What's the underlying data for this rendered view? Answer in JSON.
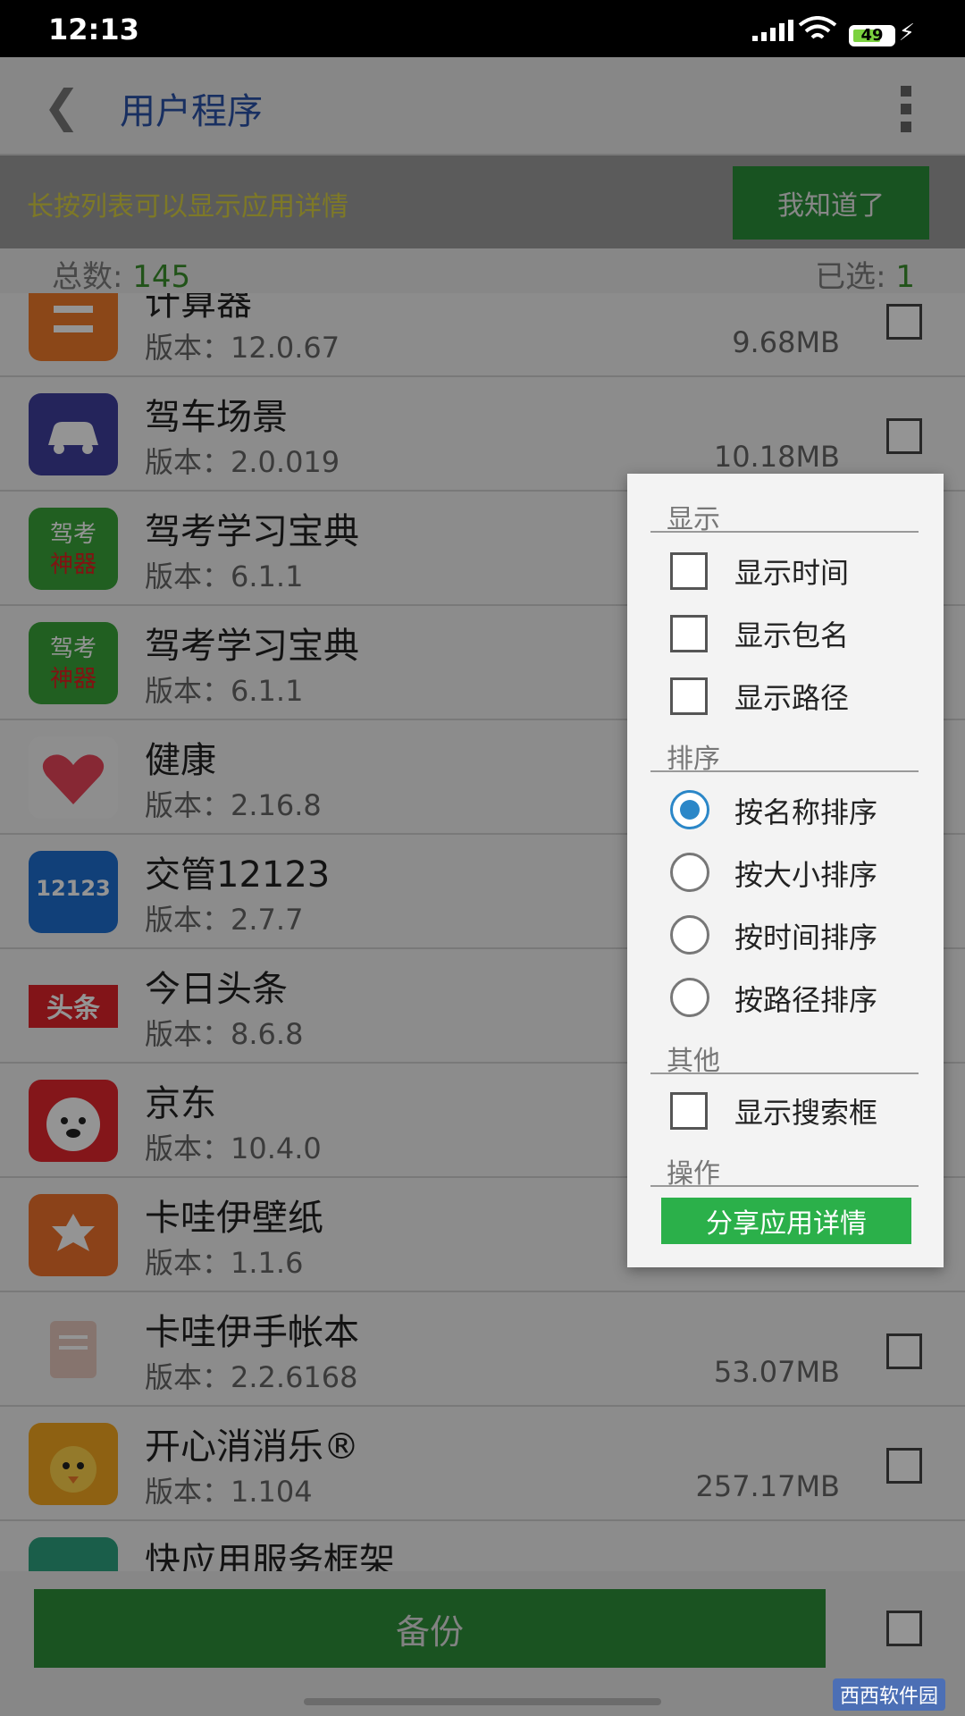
{
  "status": {
    "time": "12:13",
    "battery": "49"
  },
  "header": {
    "title": "用户程序"
  },
  "hint": {
    "text": "长按列表可以显示应用详情",
    "button": "我知道了"
  },
  "counts": {
    "total_label": "总数: ",
    "total": "145",
    "selected_label": "已选: ",
    "selected": "1"
  },
  "apps": [
    {
      "name": "计算器",
      "version": "版本：12.0.67",
      "size": "9.68MB",
      "color": "#f07a2a"
    },
    {
      "name": "驾车场景",
      "version": "版本：2.0.019",
      "size": "10.18MB",
      "color": "#3e3f9e"
    },
    {
      "name": "驾考学习宝典",
      "version": "版本：6.1.1",
      "size": "",
      "color": "#39a43a"
    },
    {
      "name": "驾考学习宝典",
      "version": "版本：6.1.1",
      "size": "",
      "color": "#39a43a"
    },
    {
      "name": "健康",
      "version": "版本：2.16.8",
      "size": "",
      "color": "#f5f5f5"
    },
    {
      "name": "交管12123",
      "version": "版本：2.7.7",
      "size": "",
      "color": "#1e6fd0"
    },
    {
      "name": "今日头条",
      "version": "版本：8.6.8",
      "size": "",
      "color": "#e0242a"
    },
    {
      "name": "京东",
      "version": "版本：10.4.0",
      "size": "",
      "color": "#e3262d"
    },
    {
      "name": "卡哇伊壁纸",
      "version": "版本：1.1.6",
      "size": "",
      "color": "#f0722c"
    },
    {
      "name": "卡哇伊手帐本",
      "version": "版本：2.2.6168",
      "size": "53.07MB",
      "color": "#e7c9be"
    },
    {
      "name": "开心消消乐®",
      "version": "版本：1.104",
      "size": "257.17MB",
      "color": "#f5a71f"
    },
    {
      "name": "快应用服务框架",
      "version": "",
      "size": "",
      "color": "#2ea380"
    }
  ],
  "menu": {
    "display": {
      "title": "显示",
      "options": [
        "显示时间",
        "显示包名",
        "显示路径"
      ]
    },
    "sort": {
      "title": "排序",
      "options": [
        "按名称排序",
        "按大小排序",
        "按时间排序",
        "按路径排序"
      ]
    },
    "other": {
      "title": "其他",
      "options": [
        "显示搜索框"
      ]
    },
    "action": {
      "title": "操作",
      "button": "分享应用详情"
    }
  },
  "bottom": {
    "backup": "备份"
  },
  "watermark": "西西软件园"
}
